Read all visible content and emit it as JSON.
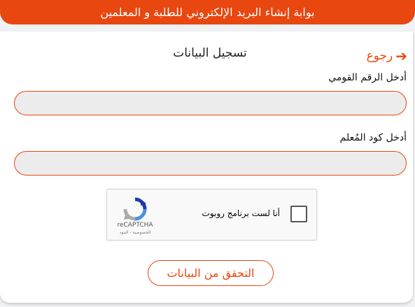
{
  "header": {
    "title": "بوابة إنشاء البريد الإلكتروني للطلبة و المعلمين"
  },
  "form": {
    "title": "تسجيل البيانات",
    "back_label": "رجوع",
    "national_id_label": "أدخل الرقم القومي",
    "national_id_value": "",
    "teacher_code_label": "أدخل كود المُعلم",
    "teacher_code_value": "",
    "submit_label": "التحقق من البيانات"
  },
  "captcha": {
    "checkbox_label": "أنا لست برنامج روبوت",
    "brand": "reCAPTCHA",
    "terms": "الخصوصية - البنود"
  },
  "colors": {
    "accent": "#e8470f",
    "input_bg": "#ececec"
  },
  "icons": {
    "back": "arrow-right-icon",
    "captcha": "recaptcha-logo-icon"
  }
}
